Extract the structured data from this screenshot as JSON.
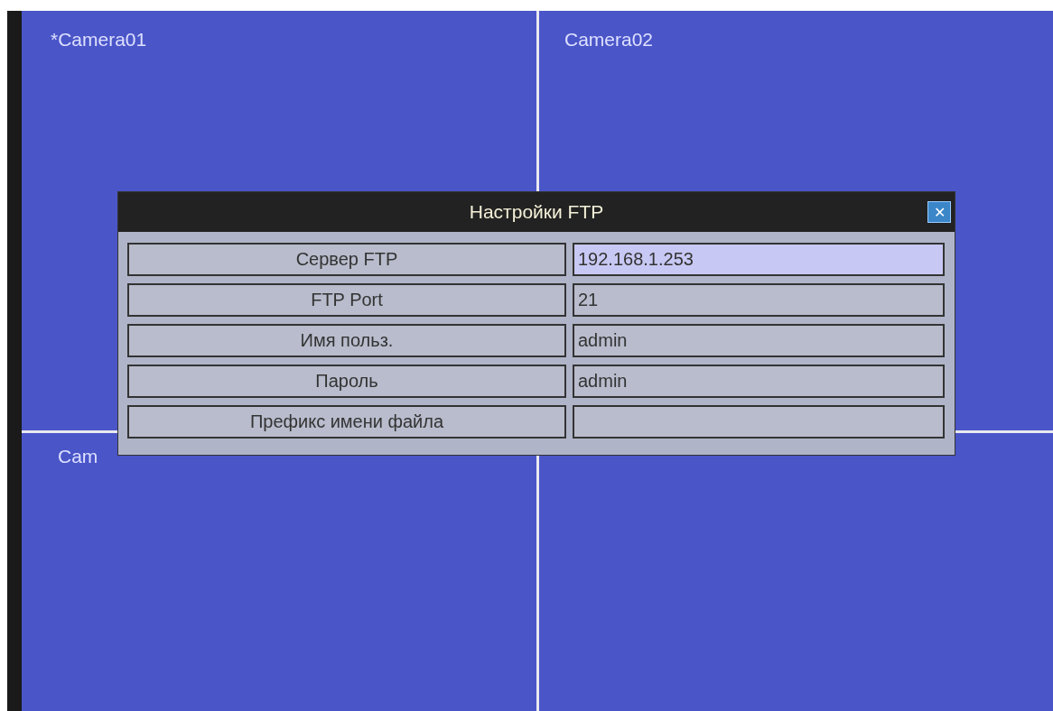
{
  "cameras": [
    {
      "label": "*Camera01"
    },
    {
      "label": "Camera02"
    },
    {
      "label": "Cam"
    }
  ],
  "dialog": {
    "title": "Настройки FTP",
    "close": "✕",
    "rows": [
      {
        "label": "Сервер FTP",
        "value": "192.168.1.253",
        "selected": true
      },
      {
        "label": "FTP Port",
        "value": "21",
        "selected": false
      },
      {
        "label": "Имя польз.",
        "value": "admin",
        "selected": false
      },
      {
        "label": "Пароль",
        "value": "admin",
        "selected": false
      },
      {
        "label": "Префикс имени файла",
        "selected": false
      }
    ]
  }
}
